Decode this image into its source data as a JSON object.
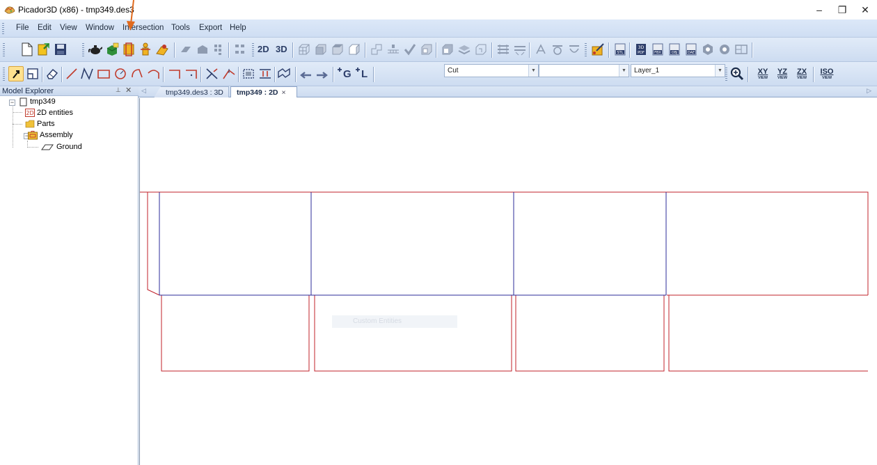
{
  "window": {
    "title": "Picador3D (x86) - tmp349.des3",
    "controls": {
      "minimize": "–",
      "maximize": "❐",
      "close": "✕"
    }
  },
  "menu": [
    "File",
    "Edit",
    "View",
    "Window",
    "Intersection",
    "Tools",
    "Export",
    "Help"
  ],
  "toolbar1": {
    "text_buttons": [
      "2D",
      "3D"
    ]
  },
  "toolbar2": {
    "group_label": "G",
    "layer_label": "L",
    "mode_combo": "Cut",
    "second_combo": "",
    "layer_combo": "Layer_1",
    "view_buttons": [
      {
        "big": "XY",
        "small": "VIEW"
      },
      {
        "big": "YZ",
        "small": "VIEW"
      },
      {
        "big": "ZX",
        "small": "VIEW"
      },
      {
        "big": "ISO",
        "small": "VIEW"
      }
    ]
  },
  "explorer": {
    "title": "Model Explorer",
    "pin": "⊥",
    "close": "✕",
    "root": "tmp349",
    "items": [
      "2D entities",
      "Parts",
      "Assembly"
    ],
    "assembly_children": [
      "Ground"
    ]
  },
  "tabs": [
    {
      "label": "tmp349.des3 : 3D"
    },
    {
      "label": "tmp349 : 2D",
      "close": "×"
    }
  ],
  "canvas": {
    "ghost_text": "Custom Entities",
    "colors": {
      "cut": "#c0202a",
      "crease": "#2b2b9a"
    }
  }
}
